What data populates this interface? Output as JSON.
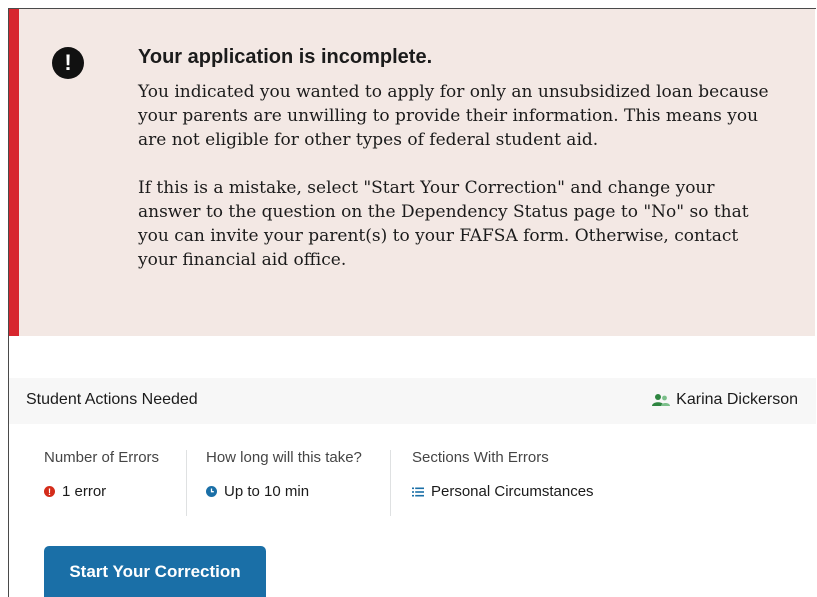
{
  "alert": {
    "icon": "exclamation-circle-icon",
    "title": "Your application is incomplete.",
    "paragraph1": "You indicated you wanted to apply for only an unsubsidized loan because your parents are unwilling to provide their information. This means you are not eligible for other types of federal student aid.",
    "paragraph2": "If this is a mistake, select \"Start Your Correction\" and change your answer to the question on the Dependency Status page to \"No\" so that you can invite your parent(s) to your FAFSA form. Otherwise, contact your financial aid office.",
    "accent_color": "#d7262e",
    "background_color": "#f3e8e4"
  },
  "actions": {
    "title": "Student Actions Needed",
    "user_icon": "users-icon",
    "user_name": "Karina Dickerson"
  },
  "stats": {
    "errors_label": "Number of Errors",
    "errors_value": "1 error",
    "errors_icon": "exclamation-icon",
    "time_label": "How long will this take?",
    "time_value": "Up to 10 min",
    "time_icon": "clock-icon",
    "sections_label": "Sections With Errors",
    "sections_value": "Personal Circumstances",
    "sections_icon": "list-icon"
  },
  "cta": {
    "label": "Start Your Correction",
    "color": "#1a6fa7"
  }
}
